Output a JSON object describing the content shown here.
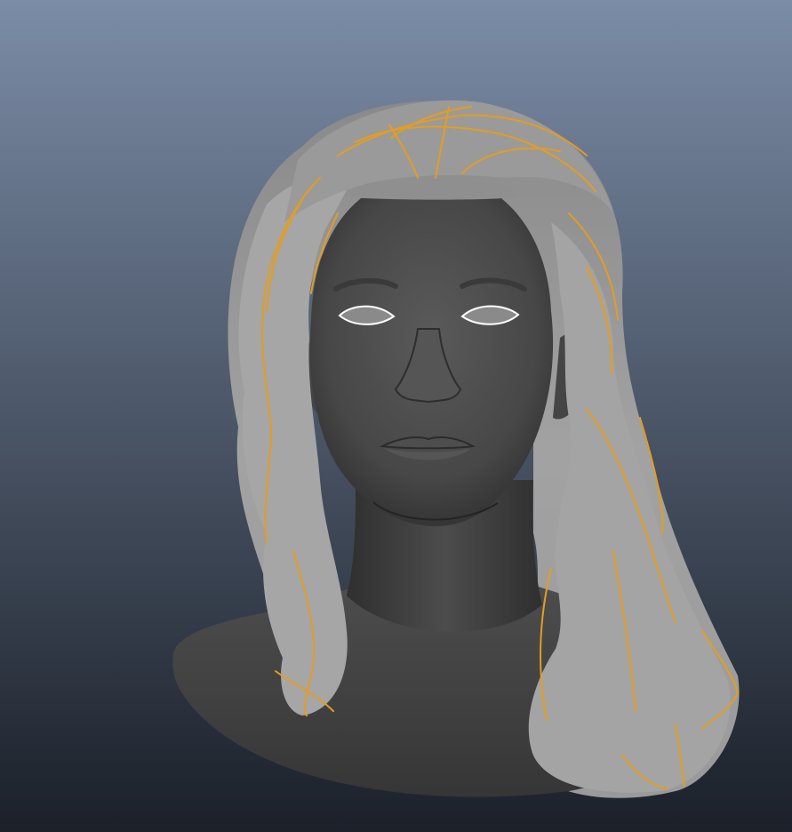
{
  "viewport": {
    "background_top": "#7b8ca6",
    "background_bottom": "#1b2029"
  },
  "model": {
    "skin_color": "#4a4a4a",
    "skin_shadow": "#2b2b2b",
    "hair_color": "#9c9c9c",
    "hair_highlight": "#c4c4c4",
    "guide_curve_color": "#e39d22",
    "eye_outline_color": "#ffffff"
  }
}
